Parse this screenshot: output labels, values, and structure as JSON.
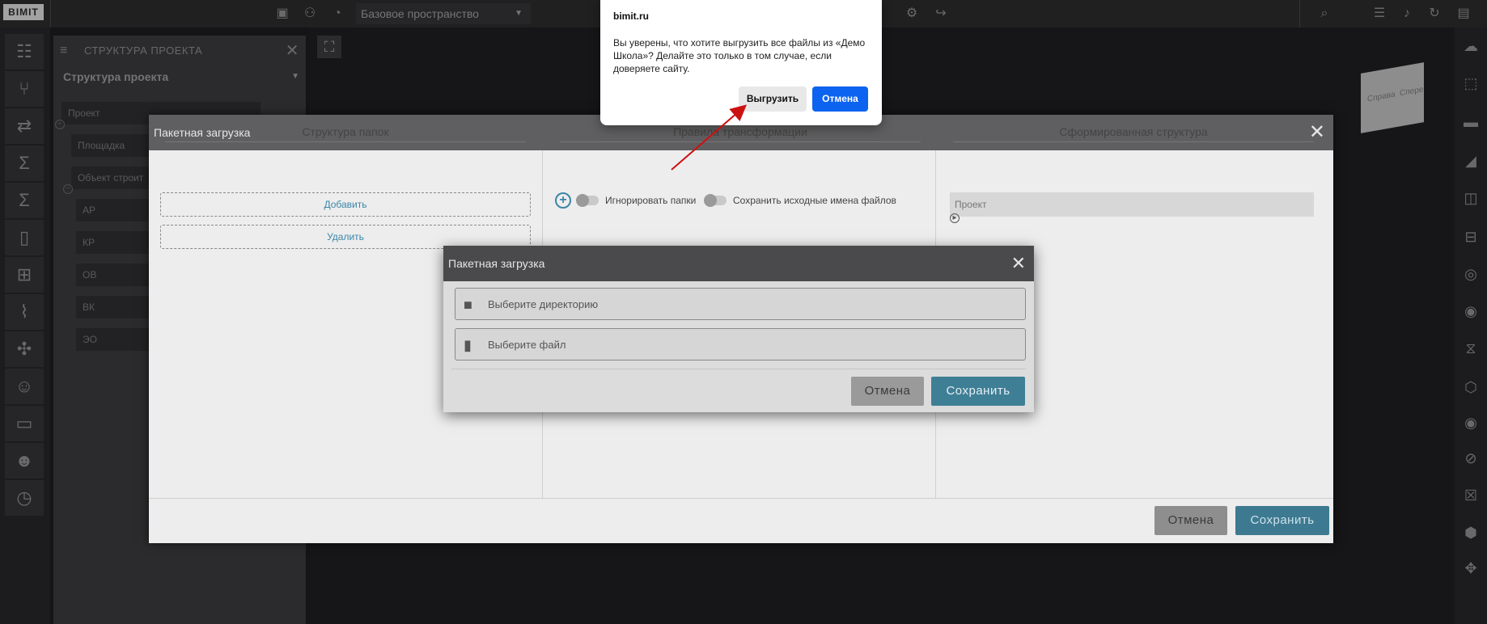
{
  "app": {
    "logo": "BIMIT",
    "space": "Базовое пространство"
  },
  "project_panel": {
    "header": "СТРУКТУРА ПРОЕКТА",
    "selector": "Структура проекта",
    "tree": [
      "Проект",
      "Площадка",
      "Объект строит",
      "АР",
      "КР",
      "ОВ",
      "ВК",
      "ЭО"
    ]
  },
  "batch_dialog": {
    "title": "Пакетная загрузка",
    "columns": {
      "folders": "Структура папок",
      "rules": "Правила трансформации",
      "result": "Сформированная структура"
    },
    "add_label": "Добавить",
    "delete_label": "Удалить",
    "ignore_folders": "Игнорировать папки",
    "keep_names": "Сохранить исходные имена файлов",
    "result_root": "Проект",
    "cancel": "Отмена",
    "save": "Сохранить"
  },
  "inner_dialog": {
    "title": "Пакетная загрузка",
    "choose_dir": "Выберите директорию",
    "choose_file": "Выберите файл",
    "cancel": "Отмена",
    "save": "Сохранить"
  },
  "confirm": {
    "site": "bimit.ru",
    "message": "Вы уверены, что хотите выгрузить все файлы из «Демо Школа»? Делайте это только в том случае, если доверяете сайту.",
    "ok": "Выгрузить",
    "cancel": "Отмена"
  },
  "viewcube": {
    "left": "Справа",
    "right": "Спере"
  },
  "colors": {
    "accent": "#3d7a92",
    "confirm_button": "#0b63f0",
    "arrow": "#cc1111"
  }
}
